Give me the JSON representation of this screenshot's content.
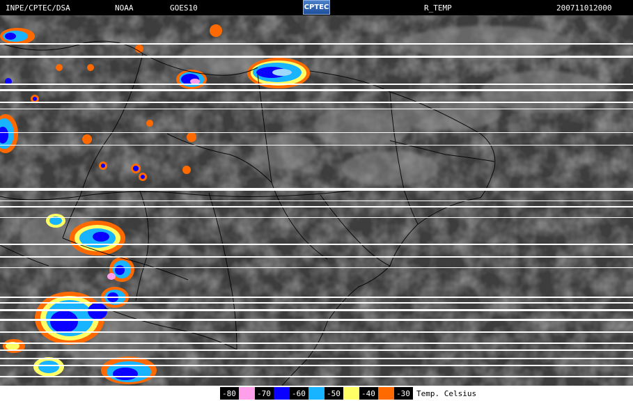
{
  "header": {
    "source": "INPE/CPTEC/DSA",
    "agency": "NOAA",
    "satellite": "GOES10",
    "logo_text": "CPTEC",
    "product": "R_TEMP",
    "timestamp": "200711012000"
  },
  "legend": {
    "unit_label": "Temp. Celsius",
    "steps": [
      {
        "label": "-80",
        "color": "#ff9fea"
      },
      {
        "label": "-70",
        "color": "#0a00ff"
      },
      {
        "label": "-60",
        "color": "#18b4ff"
      },
      {
        "label": "-50",
        "color": "#ffff66"
      },
      {
        "label": "-40",
        "color": "#ff6a00"
      },
      {
        "label": "-30",
        "color": ""
      }
    ]
  }
}
